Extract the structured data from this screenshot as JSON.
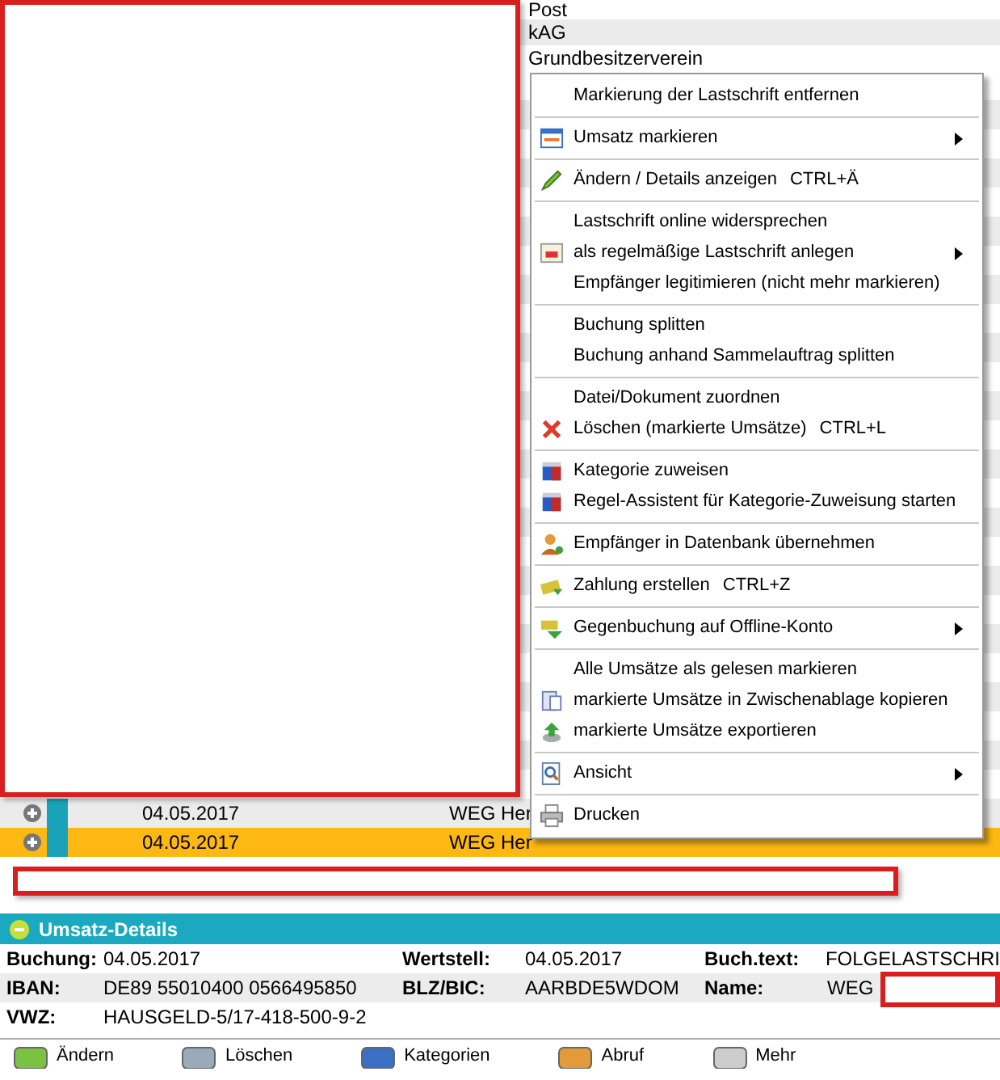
{
  "list": {
    "top_rows": [
      {
        "name": "Post"
      },
      {
        "name": "kAG"
      },
      {
        "name": "Grundbesitzerverein"
      }
    ],
    "bottom_rows": [
      {
        "date": "04.05.2017",
        "name": "WEG Her",
        "selected": false
      },
      {
        "date": "04.05.2017",
        "name": "WEG Her",
        "selected": true
      }
    ]
  },
  "context_menu": {
    "groups": [
      [
        {
          "label": "Markierung der Lastschrift entfernen",
          "submenu": false
        }
      ],
      [
        {
          "label": "Umsatz markieren",
          "submenu": true
        }
      ],
      [
        {
          "label": "Ändern / Details anzeigen",
          "shortcut": "CTRL+Ä",
          "submenu": false
        }
      ],
      [
        {
          "label": "Lastschrift online widersprechen",
          "submenu": false
        },
        {
          "label": "als regelmäßige Lastschrift anlegen",
          "submenu": true
        },
        {
          "label": "Empfänger legitimieren (nicht mehr markieren)",
          "submenu": false
        }
      ],
      [
        {
          "label": "Buchung splitten",
          "submenu": false
        },
        {
          "label": "Buchung anhand Sammelauftrag splitten",
          "submenu": false
        }
      ],
      [
        {
          "label": "Datei/Dokument zuordnen",
          "submenu": false
        },
        {
          "label": "Löschen (markierte Umsätze)",
          "shortcut": "CTRL+L",
          "submenu": false
        }
      ],
      [
        {
          "label": "Kategorie zuweisen",
          "submenu": false
        },
        {
          "label": "Regel-Assistent für Kategorie-Zuweisung starten",
          "submenu": false
        }
      ],
      [
        {
          "label": "Empfänger in Datenbank übernehmen",
          "submenu": false
        }
      ],
      [
        {
          "label": "Zahlung erstellen",
          "shortcut": "CTRL+Z",
          "submenu": false
        }
      ],
      [
        {
          "label": "Gegenbuchung auf Offline-Konto",
          "submenu": true
        }
      ],
      [
        {
          "label": "Alle Umsätze als gelesen markieren",
          "submenu": false
        },
        {
          "label": "markierte Umsätze in Zwischenablage kopieren",
          "submenu": false
        },
        {
          "label": "markierte Umsätze exportieren",
          "submenu": false
        }
      ],
      [
        {
          "label": "Ansicht",
          "submenu": true
        }
      ],
      [
        {
          "label": "Drucken",
          "submenu": false
        }
      ]
    ]
  },
  "details": {
    "title": "Umsatz-Details",
    "expanded": true,
    "rows": [
      [
        {
          "label": "Buchung:",
          "value": "04.05.2017"
        },
        {
          "label": "Wertstell:",
          "value": "04.05.2017"
        },
        {
          "label": "Buch.text:",
          "value": "FOLGELASTSCHRI"
        }
      ],
      [
        {
          "label": "IBAN:",
          "value": "DE89 55010400 0566495850"
        },
        {
          "label": "BLZ/BIC:",
          "value": "AARBDE5WDOM"
        },
        {
          "label": "Name:",
          "value": "WEG"
        }
      ],
      [
        {
          "label": "VWZ:",
          "value": "HAUSGELD-5/17-418-500-9-2"
        }
      ]
    ]
  },
  "toolbar": [
    {
      "label": "Ändern"
    },
    {
      "label": "Löschen"
    },
    {
      "label": "Kategorien"
    },
    {
      "label": "Abruf"
    },
    {
      "label": "Mehr"
    }
  ]
}
